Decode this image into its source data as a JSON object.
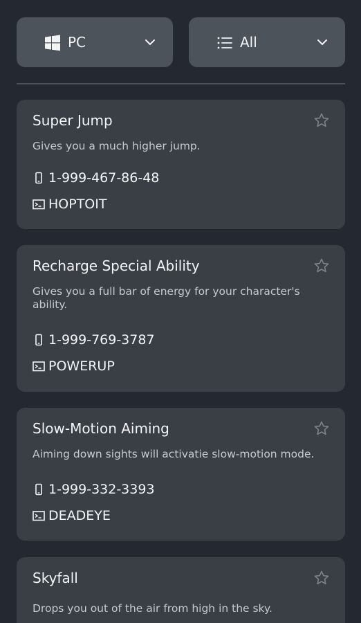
{
  "filters": {
    "platform": {
      "label": "PC",
      "icon": "windows-icon"
    },
    "category": {
      "label": "All",
      "icon": "list-icon"
    }
  },
  "cheats": [
    {
      "title": "Super Jump",
      "description": "Gives you a much higher jump.",
      "phone": "1-999-467-86-48",
      "code": "HOPTOIT"
    },
    {
      "title": "Recharge Special Ability",
      "description": "Gives you a full bar of energy for your character's ability.",
      "phone": "1-999-769-3787",
      "code": "POWERUP"
    },
    {
      "title": "Slow-Motion Aiming",
      "description": "Aiming down sights will activatie slow-motion mode.",
      "phone": "1-999-332-3393",
      "code": "DEADEYE"
    },
    {
      "title": "Skyfall",
      "description": "Drops you out of the air from high in the sky."
    }
  ],
  "colors": {
    "background": "#242830",
    "card": "#3a3f46",
    "dropdown": "#4d535b",
    "star_outline": "#7d838c"
  }
}
